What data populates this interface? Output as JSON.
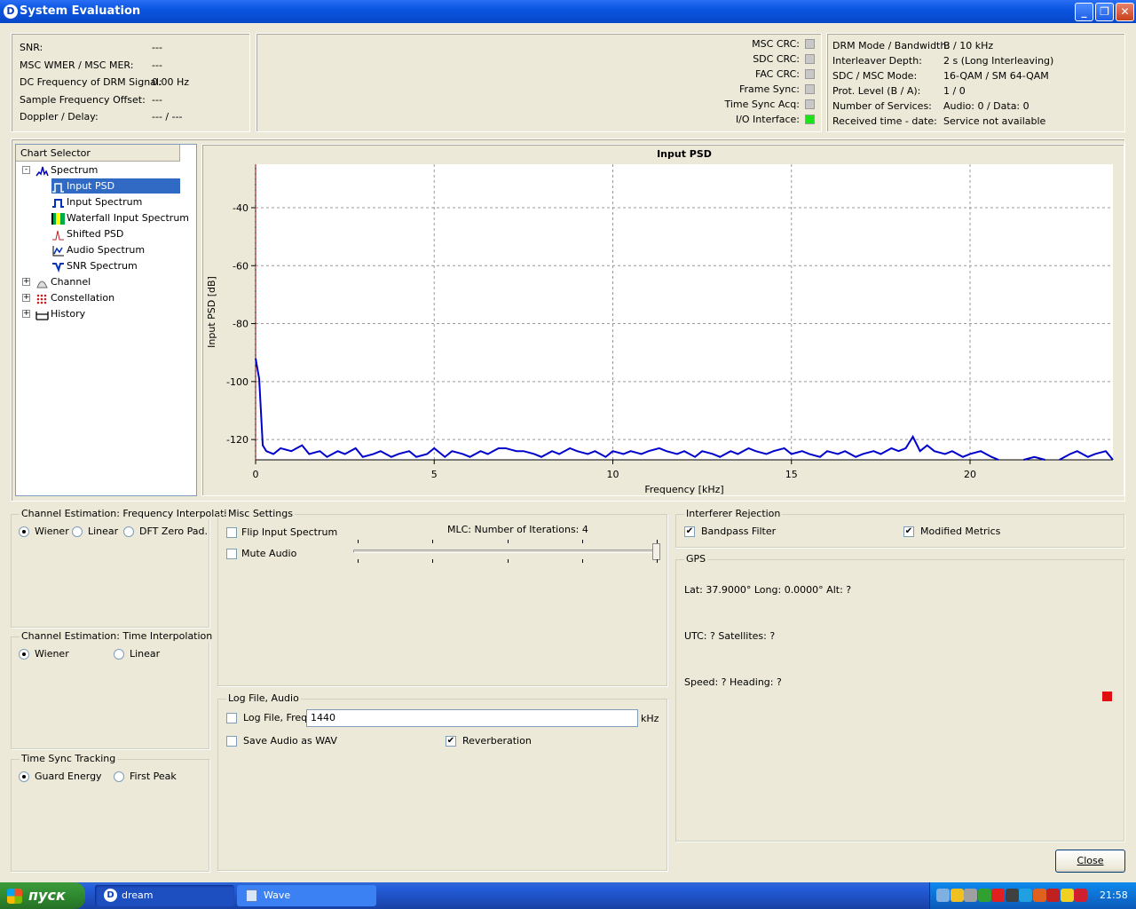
{
  "window": {
    "title": "System Evaluation",
    "icon": "dream-logo-icon"
  },
  "status": {
    "rows": [
      {
        "label": "SNR:",
        "value": "---"
      },
      {
        "label": "MSC WMER / MSC MER:",
        "value": "---"
      },
      {
        "label": "DC Frequency of DRM Signal:",
        "value": "0.00 Hz"
      },
      {
        "label": "Sample Frequency Offset:",
        "value": "---"
      },
      {
        "label": "Doppler / Delay:",
        "value": "--- / ---"
      }
    ]
  },
  "indicators": [
    {
      "label": "MSC CRC:",
      "color": "#c8c8c8"
    },
    {
      "label": "SDC CRC:",
      "color": "#c8c8c8"
    },
    {
      "label": "FAC CRC:",
      "color": "#c8c8c8"
    },
    {
      "label": "Frame Sync:",
      "color": "#c8c8c8"
    },
    {
      "label": "Time Sync Acq:",
      "color": "#c8c8c8"
    },
    {
      "label": "I/O Interface:",
      "color": "#1ce21c"
    }
  ],
  "drm_info": [
    {
      "label": "DRM Mode / Bandwidth:",
      "value": "B / 10 kHz"
    },
    {
      "label": "Interleaver Depth:",
      "value": "2 s (Long Interleaving)"
    },
    {
      "label": "SDC / MSC Mode:",
      "value": "16-QAM / SM 64-QAM"
    },
    {
      "label": "Prot. Level (B / A):",
      "value": "1 / 0"
    },
    {
      "label": "Number of Services:",
      "value": "Audio: 0 / Data: 0"
    },
    {
      "label": "Received time - date:",
      "value": "Service not available"
    }
  ],
  "chart_selector": {
    "header": "Chart Selector",
    "groups": [
      {
        "label": "Spectrum",
        "icon": "spectrum-icon",
        "expanded": "-",
        "items": [
          {
            "label": "Input PSD",
            "icon": "psd-icon",
            "selected": true
          },
          {
            "label": "Input Spectrum",
            "icon": "input-spectrum-icon"
          },
          {
            "label": "Waterfall Input Spectrum",
            "icon": "waterfall-icon"
          },
          {
            "label": "Shifted PSD",
            "icon": "shifted-psd-icon"
          },
          {
            "label": "Audio Spectrum",
            "icon": "audio-spectrum-icon"
          },
          {
            "label": "SNR Spectrum",
            "icon": "snr-spectrum-icon"
          }
        ]
      },
      {
        "label": "Channel",
        "icon": "channel-icon",
        "expanded": "+"
      },
      {
        "label": "Constellation",
        "icon": "constellation-icon",
        "expanded": "+"
      },
      {
        "label": "History",
        "icon": "history-icon",
        "expanded": "+"
      }
    ]
  },
  "chart_data": {
    "type": "line",
    "title": "Input PSD",
    "xlabel": "Frequency [kHz]",
    "ylabel": "Input PSD [dB]",
    "xlim": [
      0,
      24
    ],
    "ylim": [
      -127,
      -25
    ],
    "xticks": [
      0,
      5,
      10,
      15,
      20
    ],
    "yticks": [
      -40,
      -60,
      -80,
      -100,
      -120
    ],
    "grid": true,
    "color": "#0000cc",
    "marker_x": 0,
    "x": [
      0,
      0.1,
      0.2,
      0.3,
      0.5,
      0.7,
      1,
      1.3,
      1.5,
      1.8,
      2,
      2.3,
      2.5,
      2.8,
      3,
      3.3,
      3.5,
      3.8,
      4,
      4.3,
      4.5,
      4.8,
      5,
      5.3,
      5.5,
      5.8,
      6,
      6.3,
      6.5,
      6.8,
      7,
      7.3,
      7.5,
      7.8,
      8,
      8.3,
      8.5,
      8.8,
      9,
      9.3,
      9.5,
      9.8,
      10,
      10.3,
      10.5,
      10.8,
      11,
      11.3,
      11.5,
      11.8,
      12,
      12.3,
      12.5,
      12.8,
      13,
      13.3,
      13.5,
      13.8,
      14,
      14.3,
      14.5,
      14.8,
      15,
      15.3,
      15.5,
      15.8,
      16,
      16.3,
      16.5,
      16.8,
      17,
      17.3,
      17.5,
      17.8,
      18,
      18.2,
      18.4,
      18.6,
      18.8,
      19,
      19.3,
      19.5,
      19.8,
      20,
      20.3,
      20.6,
      20.8
    ],
    "y": [
      -92,
      -99,
      -122,
      -124,
      -125,
      -123,
      -124,
      -122,
      -125,
      -124,
      -126,
      -124,
      -125,
      -123,
      -126,
      -125,
      -124,
      -126,
      -125,
      -124,
      -126,
      -125,
      -123,
      -126,
      -124,
      -125,
      -126,
      -124,
      -125,
      -123,
      -123,
      -124,
      -124,
      -125,
      -126,
      -124,
      -125,
      -123,
      -124,
      -125,
      -124,
      -126,
      -124,
      -125,
      -124,
      -125,
      -124,
      -123,
      -124,
      -125,
      -124,
      -126,
      -124,
      -125,
      -126,
      -124,
      -125,
      -123,
      -124,
      -125,
      -124,
      -123,
      -125,
      -124,
      -125,
      -126,
      -124,
      -125,
      -124,
      -126,
      -125,
      -124,
      -125,
      -123,
      -124,
      -123,
      -119,
      -124,
      -122,
      -124,
      -125,
      -124,
      -126,
      -125,
      -124,
      -126,
      -127
    ],
    "x2": [
      21.5,
      21.8,
      22.1
    ],
    "y2": [
      -127,
      -126,
      -127
    ],
    "x3": [
      22.5,
      22.8,
      23,
      23.3,
      23.5,
      23.8,
      24
    ],
    "y3": [
      -127,
      -125,
      -124,
      -126,
      -125,
      -124,
      -127
    ]
  },
  "freq_interp": {
    "title": "Channel Estimation: Frequency Interpolation",
    "options": [
      {
        "label": "Wiener",
        "on": true
      },
      {
        "label": "Linear"
      },
      {
        "label": "DFT Zero Pad."
      }
    ]
  },
  "time_interp": {
    "title": "Channel Estimation: Time Interpolation",
    "options": [
      {
        "label": "Wiener",
        "on": true
      },
      {
        "label": "Linear"
      }
    ]
  },
  "time_sync": {
    "title": "Time Sync Tracking",
    "options": [
      {
        "label": "Guard Energy",
        "on": true
      },
      {
        "label": "First Peak"
      }
    ]
  },
  "misc": {
    "title": "Misc Settings",
    "flip": "Flip Input Spectrum",
    "mute": "Mute Audio",
    "mlc": "MLC: Number of Iterations: 4"
  },
  "log": {
    "title": "Log File, Audio",
    "logfile": "Log File, Freq:",
    "freq": "1440",
    "unit": "kHz",
    "save_wav": "Save Audio as WAV",
    "reverb": "Reverberation"
  },
  "interferer": {
    "title": "Interferer Rejection",
    "bandpass": "Bandpass Filter",
    "modified": "Modified Metrics"
  },
  "gps": {
    "title": "GPS",
    "pos": "Lat: 37.9000°  Long: 0.0000°  Alt: ?",
    "utc": "UTC: ?  Satellites: ?",
    "speed": "Speed: ?  Heading: ?",
    "led_color": "#e01010"
  },
  "close_label": "Close",
  "taskbar": {
    "start": "пуск",
    "tasks": [
      "dream",
      "Wave"
    ],
    "clock": "21:58"
  }
}
